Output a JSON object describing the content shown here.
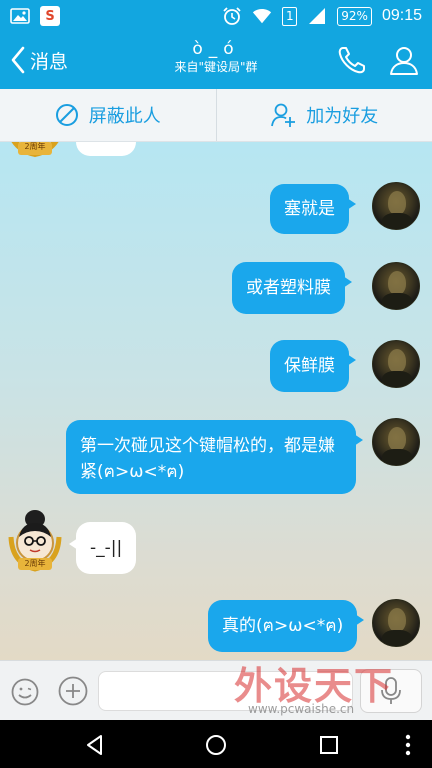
{
  "status_bar": {
    "battery": "92%",
    "time": "09:15",
    "sim": "1",
    "icons": [
      "gallery-icon",
      "sogou-app-icon",
      "alarm-icon",
      "wifi-icon",
      "sim-icon",
      "signal-icon",
      "battery-icon"
    ]
  },
  "header": {
    "back_label": "消息",
    "title_face": "ò_ó",
    "subtitle": "来自\"键设局\"群",
    "icons": [
      "back-chevron-icon",
      "phone-icon",
      "profile-icon"
    ]
  },
  "actions": {
    "block": "屏蔽此人",
    "add_friend": "加为好友"
  },
  "messages": [
    {
      "side": "right",
      "text": "塞就是"
    },
    {
      "side": "right",
      "text": "或者塑料膜"
    },
    {
      "side": "right",
      "text": "保鲜膜"
    },
    {
      "side": "right",
      "text": "第一次碰见这个键帽松的，都是嫌紧(ฅ>ω<*ฅ)"
    },
    {
      "side": "left",
      "text": "-_-||",
      "badge": "2周年"
    },
    {
      "side": "right",
      "text": "真的(ฅ>ω<*ฅ)"
    }
  ],
  "top_partial_badge": "2周年",
  "input": {
    "placeholder": ""
  },
  "watermark": {
    "main": "外设天下",
    "url": "www.pcwaishe.cn"
  },
  "colors": {
    "accent": "#12a6e0",
    "bubble_blue": "#1aa7ec",
    "action_text": "#1a9ee0"
  }
}
